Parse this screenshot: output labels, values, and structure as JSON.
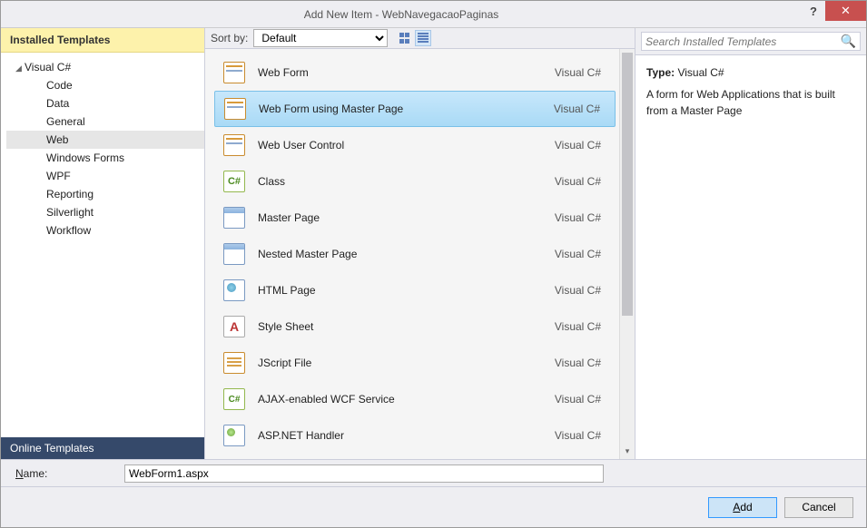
{
  "title": "Add New Item - WebNavegacaoPaginas",
  "help": "?",
  "close": "✕",
  "sidebar": {
    "header": "Installed Templates",
    "root": "Visual C#",
    "children": [
      "Code",
      "Data",
      "General",
      "Web",
      "Windows Forms",
      "WPF",
      "Reporting",
      "Silverlight",
      "Workflow"
    ],
    "selected_index": 3,
    "online": "Online Templates"
  },
  "sortbar": {
    "label": "Sort by:",
    "value": "Default"
  },
  "search": {
    "placeholder": "Search Installed Templates"
  },
  "items": [
    {
      "label": "Web Form",
      "lang": "Visual C#",
      "icon": "ico-form"
    },
    {
      "label": "Web Form using Master Page",
      "lang": "Visual C#",
      "icon": "ico-form",
      "selected": true
    },
    {
      "label": "Web User Control",
      "lang": "Visual C#",
      "icon": "ico-form"
    },
    {
      "label": "Class",
      "lang": "Visual C#",
      "icon": "ico-cs",
      "txt": "C#"
    },
    {
      "label": "Master Page",
      "lang": "Visual C#",
      "icon": "ico-page"
    },
    {
      "label": "Nested Master Page",
      "lang": "Visual C#",
      "icon": "ico-page"
    },
    {
      "label": "HTML Page",
      "lang": "Visual C#",
      "icon": "ico-html"
    },
    {
      "label": "Style Sheet",
      "lang": "Visual C#",
      "icon": "ico-css",
      "txt": "A"
    },
    {
      "label": "JScript File",
      "lang": "Visual C#",
      "icon": "ico-js"
    },
    {
      "label": "AJAX-enabled WCF Service",
      "lang": "Visual C#",
      "icon": "ico-wcf",
      "txt": "C#"
    },
    {
      "label": "ASP.NET Handler",
      "lang": "Visual C#",
      "icon": "ico-ashx"
    }
  ],
  "details": {
    "type_label": "Type:",
    "type_value": "Visual C#",
    "desc": "A form for Web Applications that is built from a Master Page"
  },
  "name_row": {
    "label_pre": "N",
    "label_post": "ame:",
    "value": "WebForm1.aspx"
  },
  "buttons": {
    "add_pre": "A",
    "add_post": "dd",
    "cancel": "Cancel"
  }
}
